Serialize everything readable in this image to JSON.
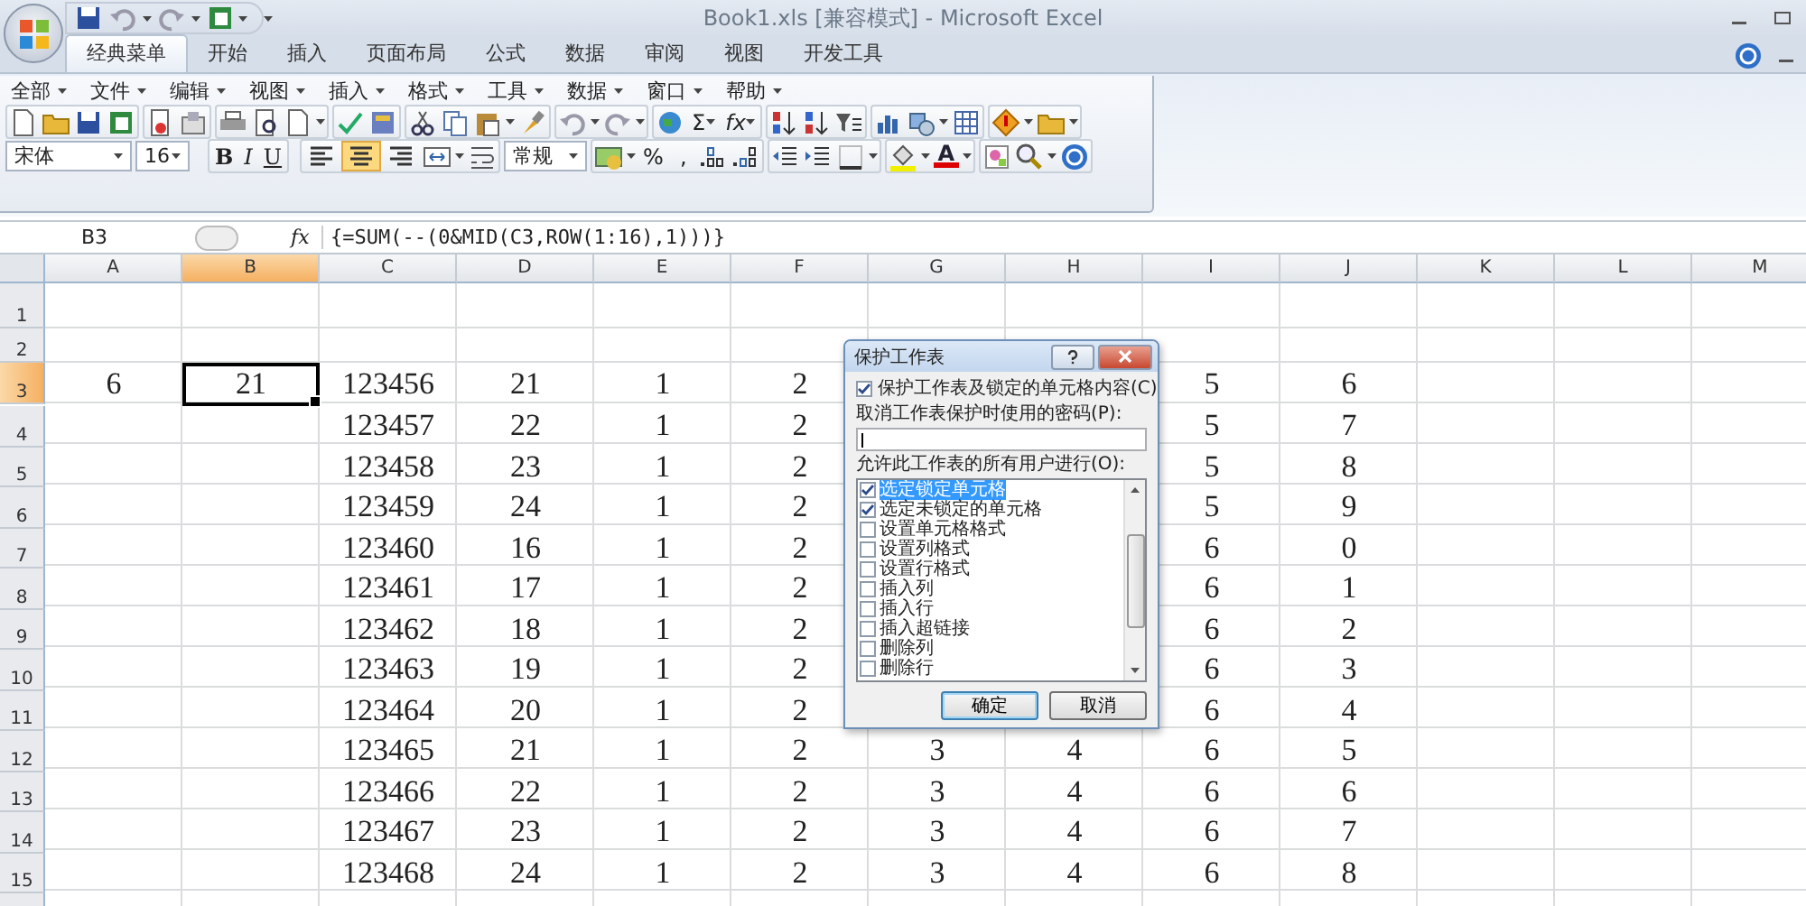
{
  "window": {
    "title": "Book1.xls  [兼容模式] - Microsoft Excel"
  },
  "tabs": [
    {
      "label": "经典菜单",
      "selected": true
    },
    {
      "label": "开始",
      "selected": false
    },
    {
      "label": "插入",
      "selected": false
    },
    {
      "label": "页面布局",
      "selected": false
    },
    {
      "label": "公式",
      "selected": false
    },
    {
      "label": "数据",
      "selected": false
    },
    {
      "label": "审阅",
      "selected": false
    },
    {
      "label": "视图",
      "selected": false
    },
    {
      "label": "开发工具",
      "selected": false
    }
  ],
  "menus": [
    "全部",
    "文件",
    "编辑",
    "视图",
    "插入",
    "格式",
    "工具",
    "数据",
    "窗口",
    "帮助"
  ],
  "toolbar": {
    "sum": "Σ",
    "function": "fx",
    "font": "宋体",
    "size": "16",
    "bold": "B",
    "italic": "I",
    "underline": "U",
    "number_format": "常规",
    "percent": "%",
    "comma": ",",
    "font_color": "A"
  },
  "align_buttons": [
    {
      "selected": false
    },
    {
      "selected": true
    },
    {
      "selected": false
    }
  ],
  "formula_bar": {
    "name_box": "B3",
    "fx": "fx",
    "formula": "{=SUM(--(0&MID(C3,ROW(1:16),1)))}"
  },
  "columns": [
    {
      "label": "A",
      "selected": false
    },
    {
      "label": "B",
      "selected": true
    },
    {
      "label": "C",
      "selected": false
    },
    {
      "label": "D",
      "selected": false
    },
    {
      "label": "E",
      "selected": false
    },
    {
      "label": "F",
      "selected": false
    },
    {
      "label": "G",
      "selected": false
    },
    {
      "label": "H",
      "selected": false
    },
    {
      "label": "I",
      "selected": false
    },
    {
      "label": "J",
      "selected": false
    },
    {
      "label": "K",
      "selected": false
    },
    {
      "label": "L",
      "selected": false
    },
    {
      "label": "M",
      "selected": false
    }
  ],
  "rows": [
    {
      "label": "1",
      "selected": false
    },
    {
      "label": "2",
      "selected": false
    },
    {
      "label": "3",
      "selected": true,
      "cells": {
        "A": "6",
        "B": "21",
        "C": "123456",
        "D": "21",
        "E": "1",
        "F": "2",
        "I": "5",
        "J": "6"
      }
    },
    {
      "label": "4",
      "selected": false,
      "cells": {
        "C": "123457",
        "D": "22",
        "E": "1",
        "F": "2",
        "I": "5",
        "J": "7"
      }
    },
    {
      "label": "5",
      "selected": false,
      "cells": {
        "C": "123458",
        "D": "23",
        "E": "1",
        "F": "2",
        "I": "5",
        "J": "8"
      }
    },
    {
      "label": "6",
      "selected": false,
      "cells": {
        "C": "123459",
        "D": "24",
        "E": "1",
        "F": "2",
        "I": "5",
        "J": "9"
      }
    },
    {
      "label": "7",
      "selected": false,
      "cells": {
        "C": "123460",
        "D": "16",
        "E": "1",
        "F": "2",
        "I": "6",
        "J": "0"
      }
    },
    {
      "label": "8",
      "selected": false,
      "cells": {
        "C": "123461",
        "D": "17",
        "E": "1",
        "F": "2",
        "I": "6",
        "J": "1"
      }
    },
    {
      "label": "9",
      "selected": false,
      "cells": {
        "C": "123462",
        "D": "18",
        "E": "1",
        "F": "2",
        "I": "6",
        "J": "2"
      }
    },
    {
      "label": "10",
      "selected": false,
      "cells": {
        "C": "123463",
        "D": "19",
        "E": "1",
        "F": "2",
        "I": "6",
        "J": "3"
      }
    },
    {
      "label": "11",
      "selected": false,
      "cells": {
        "C": "123464",
        "D": "20",
        "E": "1",
        "F": "2",
        "I": "6",
        "J": "4"
      }
    },
    {
      "label": "12",
      "selected": false,
      "cells": {
        "C": "123465",
        "D": "21",
        "E": "1",
        "F": "2",
        "G": "3",
        "H": "4",
        "I": "6",
        "J": "5"
      }
    },
    {
      "label": "13",
      "selected": false,
      "cells": {
        "C": "123466",
        "D": "22",
        "E": "1",
        "F": "2",
        "G": "3",
        "H": "4",
        "I": "6",
        "J": "6"
      }
    },
    {
      "label": "14",
      "selected": false,
      "cells": {
        "C": "123467",
        "D": "23",
        "E": "1",
        "F": "2",
        "G": "3",
        "H": "4",
        "I": "6",
        "J": "7"
      }
    },
    {
      "label": "15",
      "selected": false,
      "cells": {
        "C": "123468",
        "D": "24",
        "E": "1",
        "F": "2",
        "G": "3",
        "H": "4",
        "I": "6",
        "J": "8"
      }
    }
  ],
  "dialog": {
    "title": "保护工作表",
    "protect": {
      "label": "保护工作表及锁定的单元格内容(C)",
      "checked": true
    },
    "password_label": "取消工作表保护时使用的密码(P):",
    "permissions_label": "允许此工作表的所有用户进行(O):",
    "permissions": [
      {
        "label": "选定锁定单元格",
        "checked": true,
        "selected": true
      },
      {
        "label": "选定未锁定的单元格",
        "checked": true,
        "selected": false
      },
      {
        "label": "设置单元格格式",
        "checked": false,
        "selected": false
      },
      {
        "label": "设置列格式",
        "checked": false,
        "selected": false
      },
      {
        "label": "设置行格式",
        "checked": false,
        "selected": false
      },
      {
        "label": "插入列",
        "checked": false,
        "selected": false
      },
      {
        "label": "插入行",
        "checked": false,
        "selected": false
      },
      {
        "label": "插入超链接",
        "checked": false,
        "selected": false
      },
      {
        "label": "删除列",
        "checked": false,
        "selected": false
      },
      {
        "label": "删除行",
        "checked": false,
        "selected": false
      }
    ],
    "buttons": [
      "确定",
      "取消"
    ]
  }
}
